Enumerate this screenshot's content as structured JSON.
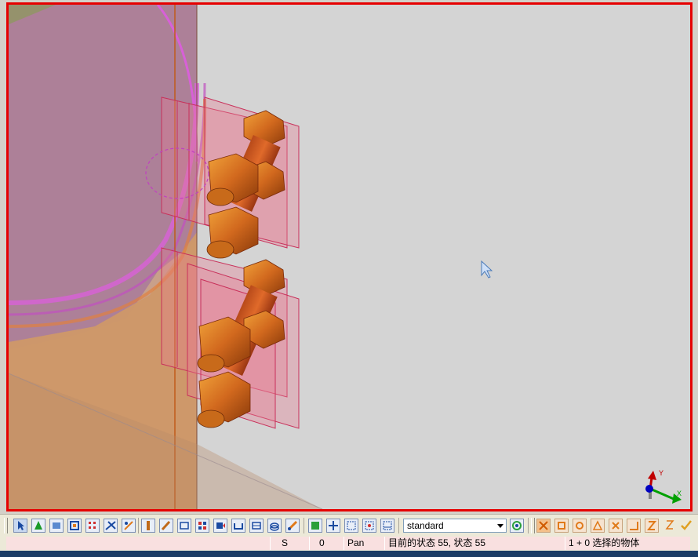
{
  "viewport": {
    "frame_color": "#e60000",
    "background": "#d4d4d4",
    "cursor": "arrow-cursor-icon",
    "axis_triad": {
      "x_label": "X",
      "y_label": "Y",
      "x_color": "#00a000",
      "y_color": "#c00000",
      "z_color": "#0000c0"
    }
  },
  "toolbar": {
    "view_select_value": "standard",
    "selection_tools": [
      "select-pointer-icon",
      "select-part-icon",
      "select-surface-icon",
      "select-object-icon",
      "select-grid-icon",
      "select-cut-icon",
      "select-weld-icon",
      "select-reinforcement-icon",
      "select-component-icon",
      "select-assembly-icon",
      "select-in-component-icon",
      "select-single-icon",
      "select-group-icon",
      "select-bolt-icon",
      "select-hole-icon",
      "select-pour-icon",
      "select-line-icon"
    ],
    "view_tools": [
      "view-zoom-icon",
      "view-pan-icon",
      "view-fit-icon",
      "view-rotate-icon",
      "view-work-area-icon"
    ],
    "snap_tools": [
      "snap-reference-icon",
      "snap-geometry-icon",
      "snap-center-icon",
      "snap-midpoint-icon",
      "snap-intersection-icon",
      "snap-perpendicular-icon",
      "snap-nearest-icon"
    ],
    "confirm_icon": "checkmark-icon",
    "colors": {
      "selection_btn": "#e8eef8",
      "snap_btn": "#f6e3cf",
      "snap_accent": "#e07a1a"
    }
  },
  "statusbar": {
    "cell1": "",
    "cell2": "S",
    "cell3": "0",
    "cell4": "Pan",
    "cell5": "目前的状态 55, 状态 55",
    "cell6": "1 + 0 选择的物体"
  }
}
